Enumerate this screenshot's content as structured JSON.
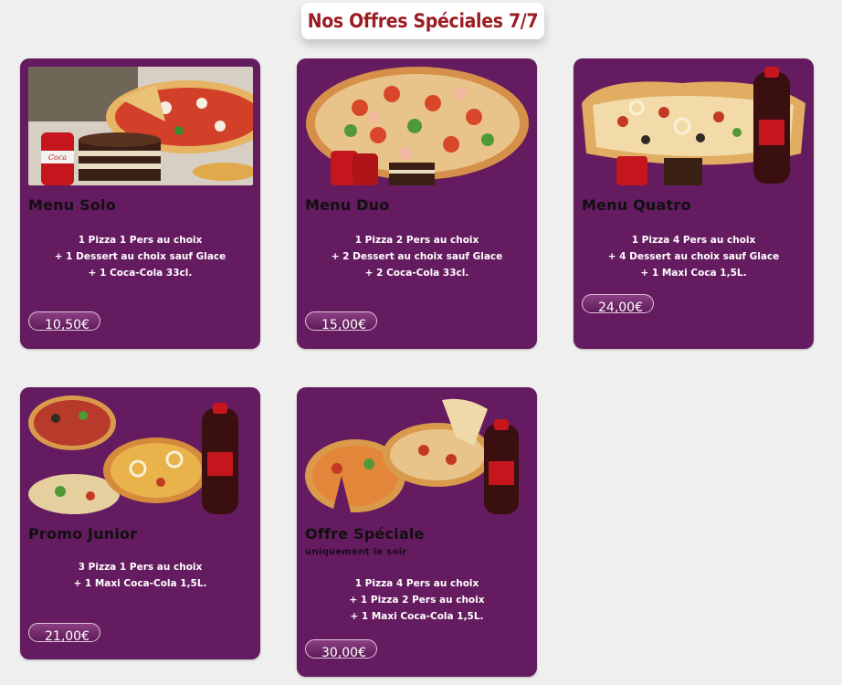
{
  "header": {
    "title": "Nos Offres Spéciales 7/7"
  },
  "offers": [
    {
      "title": "Menu Solo",
      "subtitle": "",
      "lines": [
        "1 Pizza 1 Pers au choix",
        "+ 1 Dessert au choix sauf Glace",
        "+ 1 Coca-Cola 33cl."
      ],
      "price": "10,50€",
      "image": "pizza-dessert-coca-photo"
    },
    {
      "title": "Menu Duo",
      "subtitle": "",
      "lines": [
        "1 Pizza 2 Pers au choix",
        "+ 2 Dessert au choix sauf Glace",
        "+ 2 Coca-Cola 33cl."
      ],
      "price": "15,00€",
      "image": "large-pizza-photo"
    },
    {
      "title": "Menu Quatro",
      "subtitle": "",
      "lines": [
        "1 Pizza 4 Pers au choix",
        "+ 4 Dessert au choix sauf Glace",
        "+ 1 Maxi Coca 1,5L."
      ],
      "price": "24,00€",
      "image": "family-pizza-coca-bottle-photo"
    },
    {
      "title": "Promo Junior",
      "subtitle": "",
      "lines": [
        "3 Pizza 1 Pers au choix",
        "+ 1 Maxi Coca-Cola 1,5L."
      ],
      "price": "21,00€",
      "image": "three-pizzas-coca-bottle-photo"
    },
    {
      "title": "Offre Spéciale",
      "subtitle": "uniquement le soir",
      "lines": [
        "1 Pizza 4 Pers au choix",
        "+ 1 Pizza 2 Pers au choix",
        "+ 1 Maxi Coca-Cola 1,5L."
      ],
      "price": "30,00€",
      "image": "two-pizzas-coca-bottle-photo"
    }
  ],
  "colors": {
    "card": "#651b60",
    "title": "#9b1c22",
    "background": "#efefef"
  }
}
